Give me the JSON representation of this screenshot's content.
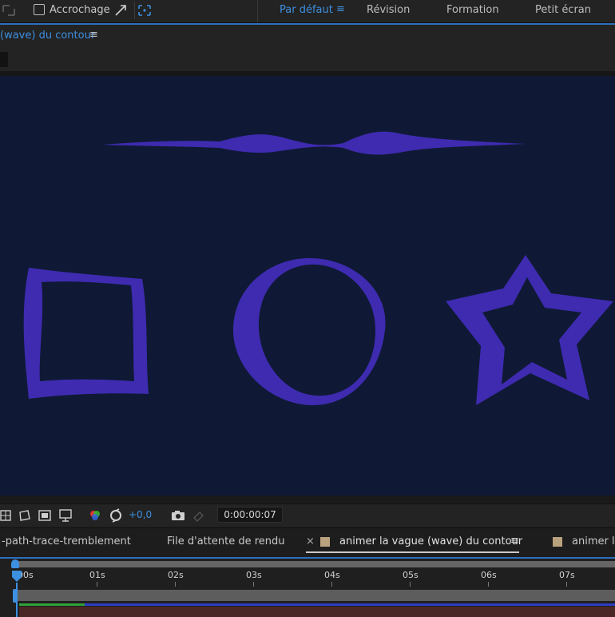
{
  "toolbar": {
    "snap_label": "Accrochage",
    "workspaces": [
      "Par défaut",
      "Révision",
      "Formation",
      "Petit écran"
    ],
    "active_workspace_menu": "≡"
  },
  "composition_panel": {
    "title": "(wave) du contour",
    "menu_glyph": "≡"
  },
  "viewer": {
    "background": "#0f1935",
    "shape_color": "#3e2bb0",
    "shapes": [
      "wave-line",
      "square",
      "circle",
      "star"
    ]
  },
  "viewer_controls": {
    "exposure": "+0,0",
    "current_time": "0:00:00:07"
  },
  "tabs": [
    {
      "label": "-path-trace-tremblement"
    },
    {
      "label": "File d'attente de rendu"
    },
    {
      "label": "animer la vague (wave) du contour",
      "close": "×",
      "menu": "≡",
      "active": true
    },
    {
      "label": "animer la"
    }
  ],
  "timeline": {
    "ruler_labels": [
      "00s",
      "01s",
      "02s",
      "03s",
      "04s",
      "05s",
      "06s",
      "07s"
    ]
  },
  "colors": {
    "accent": "#3d8fe0",
    "panel": "#232323",
    "label_swatch": "#b9a27e",
    "cache_green": "#2ea13a"
  }
}
